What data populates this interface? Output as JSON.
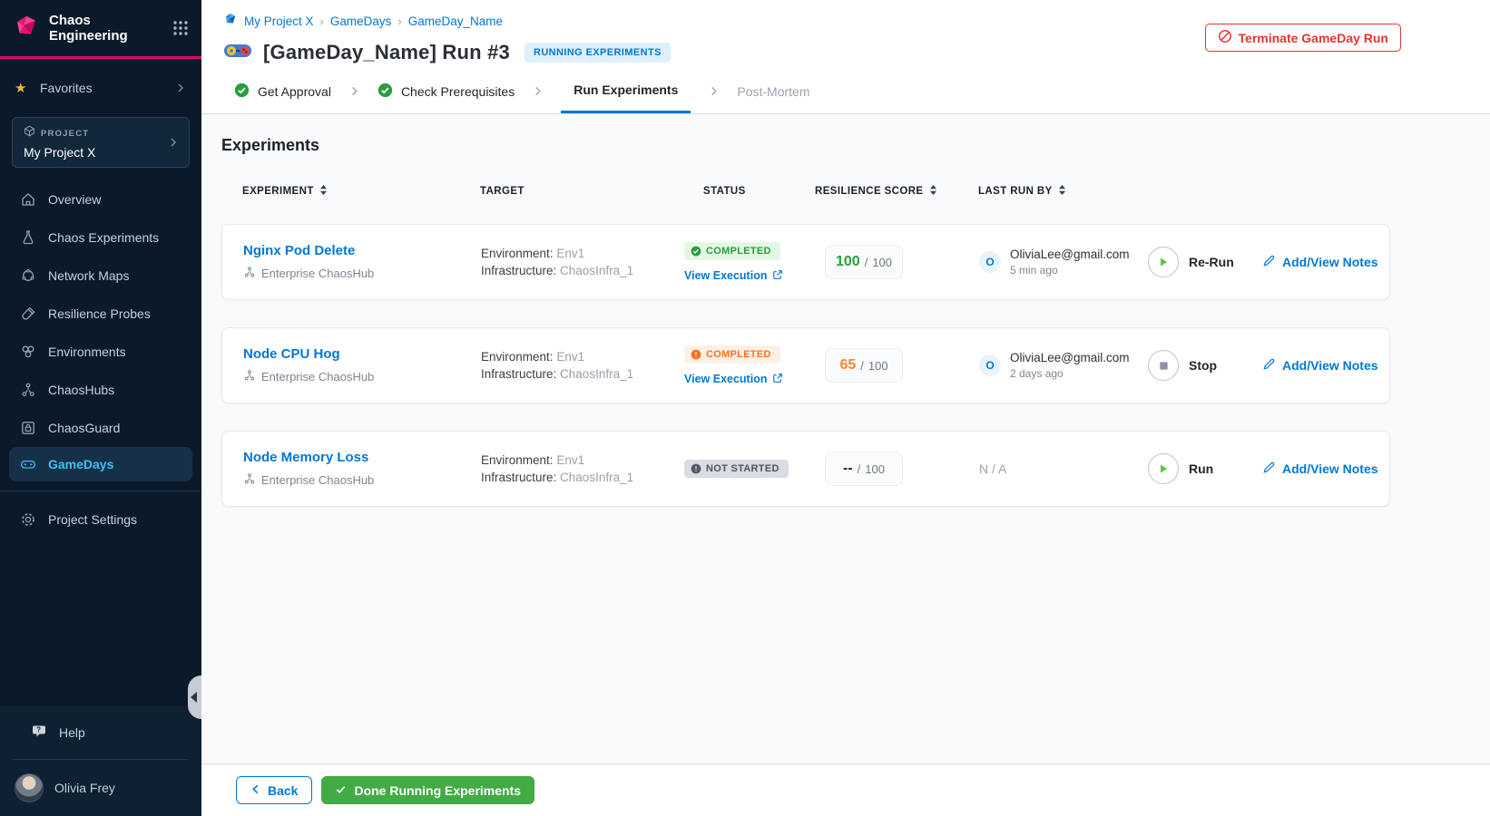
{
  "colors": {
    "accent_blue": "#0278D5",
    "brand_pink": "#D9066B",
    "success_green": "#2A9D3D",
    "warning_orange": "#FF7020",
    "danger_red": "#E3342F",
    "button_green": "#42AB45",
    "sidebar_bg": "#0B1A2B",
    "active_nav_text": "#3EC1F2"
  },
  "sidebar": {
    "brand": {
      "line1": "Chaos",
      "line2": "Engineering"
    },
    "favorites_label": "Favorites",
    "project": {
      "label": "PROJECT",
      "name": "My Project X"
    },
    "nav": [
      {
        "label": "Overview"
      },
      {
        "label": "Chaos Experiments"
      },
      {
        "label": "Network Maps"
      },
      {
        "label": "Resilience Probes"
      },
      {
        "label": "Environments"
      },
      {
        "label": "ChaosHubs"
      },
      {
        "label": "ChaosGuard"
      },
      {
        "label": "GameDays"
      }
    ],
    "settings_label": "Project Settings",
    "help_label": "Help",
    "user_name": "Olivia Frey"
  },
  "header": {
    "breadcrumb": {
      "items": [
        "My Project X",
        "GameDays",
        "GameDay_Name"
      ],
      "separator": "›"
    },
    "title": "[GameDay_Name] Run #3",
    "status_badge": "RUNNING EXPERIMENTS",
    "terminate_label": "Terminate GameDay Run"
  },
  "stepper": {
    "steps": [
      {
        "label": "Get Approval",
        "state": "done"
      },
      {
        "label": "Check Prerequisites",
        "state": "done"
      },
      {
        "label": "Run Experiments",
        "state": "active"
      },
      {
        "label": "Post-Mortem",
        "state": "upcoming"
      }
    ]
  },
  "main": {
    "section_title": "Experiments",
    "table": {
      "columns": [
        "EXPERIMENT",
        "TARGET",
        "STATUS",
        "RESILIENCE SCORE",
        "LAST RUN BY"
      ],
      "score_separator": "/",
      "rows": [
        {
          "name": "Nginx Pod Delete",
          "hub": "Enterprise ChaosHub",
          "target": {
            "env_label": "Environment:",
            "env": "Env1",
            "infra_label": "Infrastructure:",
            "infra": "ChaosInfra_1"
          },
          "status": {
            "label": "COMPLETED",
            "type": "success"
          },
          "view_execution": "View Execution",
          "score": {
            "value": "100",
            "max": "100"
          },
          "last_run": {
            "initial": "O",
            "email": "OliviaLee@gmail.com",
            "when": "5 min ago"
          },
          "action": "Re-Run",
          "notes": "Add/View Notes"
        },
        {
          "name": "Node CPU Hog",
          "hub": "Enterprise ChaosHub",
          "target": {
            "env_label": "Environment:",
            "env": "Env1",
            "infra_label": "Infrastructure:",
            "infra": "ChaosInfra_1"
          },
          "status": {
            "label": "COMPLETED",
            "type": "warning"
          },
          "view_execution": "View Execution",
          "score": {
            "value": "65",
            "max": "100"
          },
          "last_run": {
            "initial": "O",
            "email": "OliviaLee@gmail.com",
            "when": "2 days ago"
          },
          "action": "Stop",
          "notes": "Add/View Notes"
        },
        {
          "name": "Node Memory Loss",
          "hub": "Enterprise ChaosHub",
          "target": {
            "env_label": "Environment:",
            "env": "Env1",
            "infra_label": "Infrastructure:",
            "infra": "ChaosInfra_1"
          },
          "status": {
            "label": "NOT STARTED",
            "type": "neutral"
          },
          "score": {
            "value": "--",
            "max": "100"
          },
          "last_run": {
            "na": "N / A"
          },
          "action": "Run",
          "notes": "Add/View Notes"
        }
      ]
    }
  },
  "footer": {
    "back_label": "Back",
    "done_label": "Done Running Experiments"
  }
}
